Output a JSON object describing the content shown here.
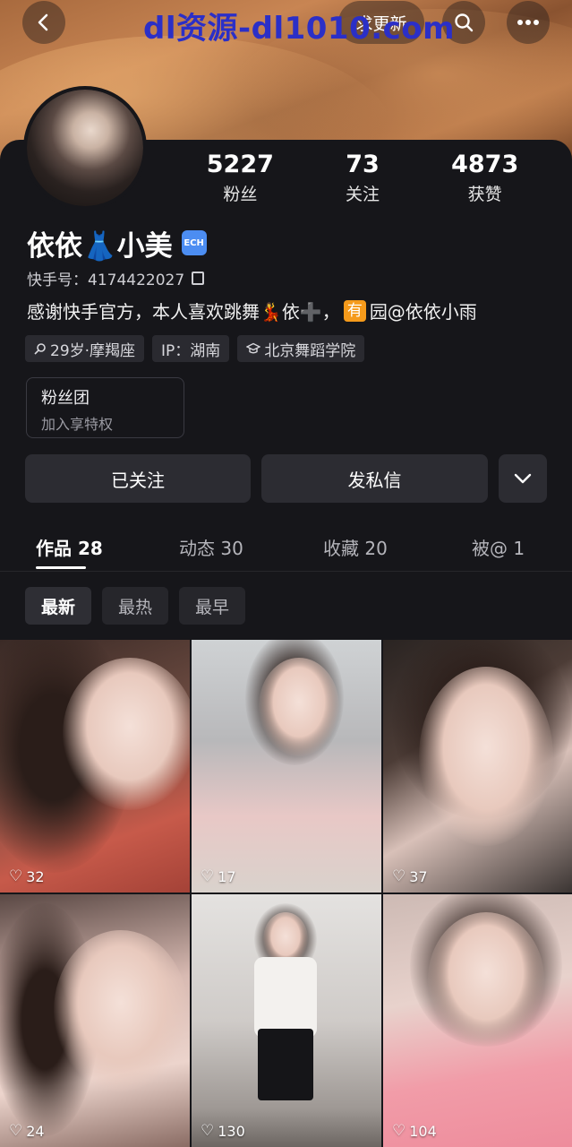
{
  "header": {
    "watermark": "dl资源-dl1010.com",
    "follow_pill": "求更新"
  },
  "profile": {
    "stats": [
      {
        "value": "5227",
        "label": "粉丝"
      },
      {
        "value": "73",
        "label": "关注"
      },
      {
        "value": "4873",
        "label": "获赞"
      }
    ],
    "name": "依依👗小美",
    "badge": "ECH",
    "kuaishou_id": "快手号：4174422027",
    "bio_prefix": "感谢快手官方，本人喜欢跳舞💃依➕，",
    "bio_tag": "有",
    "bio_suffix": "园@依依小雨",
    "chips": [
      "29岁·摩羯座",
      "IP：湖南",
      "北京舞蹈学院"
    ],
    "fanclub": {
      "title": "粉丝团",
      "subtitle": "加入享特权"
    }
  },
  "actions": {
    "followed": "已关注",
    "message": "发私信"
  },
  "tabs": [
    "作品 28",
    "动态 30",
    "收藏 20",
    "被@ 1"
  ],
  "sort": [
    "最新",
    "最热",
    "最早"
  ],
  "posts": [
    {
      "likes": "32"
    },
    {
      "likes": "17"
    },
    {
      "likes": "37"
    },
    {
      "likes": "24"
    },
    {
      "likes": "130"
    },
    {
      "likes": "104"
    }
  ],
  "colors": {
    "background": "#16161a",
    "button": "#2c2c32",
    "verified_badge": "#4c8df2",
    "tag_you": "#f59a1b"
  }
}
